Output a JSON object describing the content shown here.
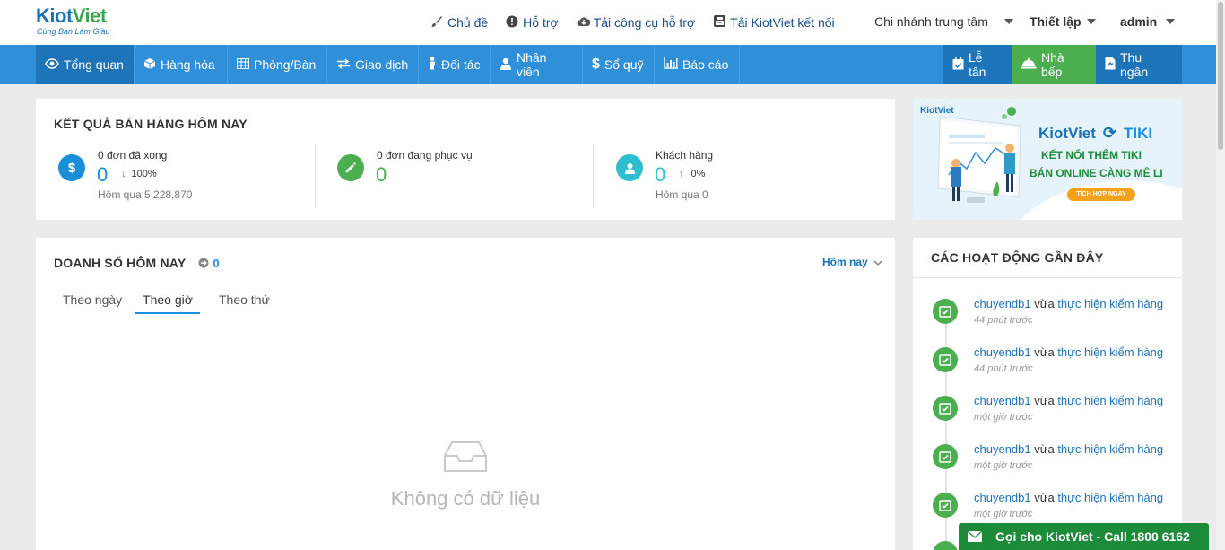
{
  "logo": {
    "main_k": "Kiot",
    "main_v": "Viet",
    "tagline": "Cùng Bạn Làm Giàu"
  },
  "toplinks": [
    {
      "label": "Chủ đề",
      "icon": "brush-icon"
    },
    {
      "label": "Hỗ trợ",
      "icon": "info-icon"
    },
    {
      "label": "Tải công cụ hỗ trợ",
      "icon": "cloud-download-icon"
    },
    {
      "label": "Tải KiotViet kết nối",
      "icon": "printer-icon"
    }
  ],
  "branch": "Chi nhánh trung tâm",
  "settings": "Thiết lập",
  "user": "admin",
  "nav": [
    {
      "label": "Tổng quan",
      "icon": "eye-icon"
    },
    {
      "label": "Hàng hóa",
      "icon": "cube-icon"
    },
    {
      "label": "Phòng/Bàn",
      "icon": "table-icon"
    },
    {
      "label": "Giao dịch",
      "icon": "exchange-icon"
    },
    {
      "label": "Đối tác",
      "icon": "person-icon"
    },
    {
      "label": "Nhân viên",
      "icon": "staff-icon"
    },
    {
      "label": "Sổ quỹ",
      "icon": "dollar-icon"
    },
    {
      "label": "Báo cáo",
      "icon": "bar-chart-icon"
    }
  ],
  "nav_right": [
    {
      "label": "Lễ tân",
      "icon": "calendar-icon"
    },
    {
      "label": "Nhà bếp",
      "icon": "cloche-icon"
    },
    {
      "label": "Thu ngân",
      "icon": "cashier-icon"
    }
  ],
  "sales_today": {
    "title": "KẾT QUẢ BÁN HÀNG HÔM NAY",
    "done": {
      "label": "0 đơn đã xong",
      "value": "0",
      "pct": "100%",
      "sub": "Hôm qua 5,228,870"
    },
    "serving": {
      "label": "0 đơn đang phục vụ",
      "value": "0"
    },
    "customers": {
      "label": "Khách hàng",
      "value": "0",
      "pct": "0%",
      "sub": "Hôm qua 0"
    }
  },
  "banner": {
    "brand_a": "KiotViet",
    "brand_b": "TIKI",
    "line1": "KẾT NỐI THÊM TIKI",
    "line2": "BÁN ONLINE CÀNG MÊ LI",
    "cta": "TÍCH HỢP NGAY",
    "logo_small": "KiotViet"
  },
  "revenue": {
    "title": "DOANH SỐ HÔM NAY",
    "count": "0",
    "period": "Hôm nay",
    "tabs": [
      "Theo ngày",
      "Theo giờ",
      "Theo thứ"
    ],
    "active_tab": "Theo giờ",
    "empty": "Không có dữ liệu"
  },
  "activities": {
    "title": "CÁC HOẠT ĐỘNG GẦN ĐÂY",
    "items": [
      {
        "user": "chuyendb1",
        "verb": "vừa",
        "action": "thực hiện kiểm hàng",
        "time": "44 phút trước"
      },
      {
        "user": "chuyendb1",
        "verb": "vừa",
        "action": "thực hiện kiểm hàng",
        "time": "44 phút trước"
      },
      {
        "user": "chuyendb1",
        "verb": "vừa",
        "action": "thực hiện kiểm hàng",
        "time": "một giờ trước"
      },
      {
        "user": "chuyendb1",
        "verb": "vừa",
        "action": "thực hiện kiểm hàng",
        "time": "một giờ trước"
      },
      {
        "user": "chuyendb1",
        "verb": "vừa",
        "action": "thực hiện kiểm hàng",
        "time": "một giờ trước"
      }
    ]
  },
  "call": {
    "label": "Gọi cho KiotViet - Call 1800 6162"
  },
  "colors": {
    "nav": "#2f8fd9",
    "nav_active": "#1d74b8",
    "green": "#4bae4f",
    "link": "#1a73b8",
    "call": "#1d8c3a"
  }
}
